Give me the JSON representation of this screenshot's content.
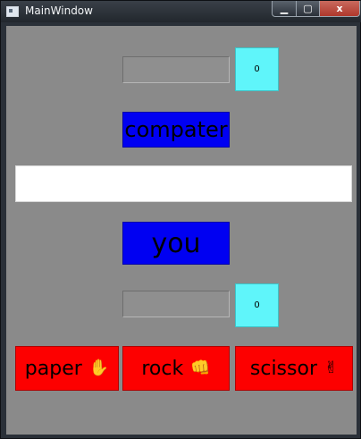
{
  "window": {
    "title": "MainWindow"
  },
  "controls": {
    "minimize": "▁",
    "maximize": "▢",
    "close": "x"
  },
  "computer": {
    "label": "compater",
    "score": "0"
  },
  "you": {
    "label": "you",
    "score": "0"
  },
  "buttons": {
    "paper": {
      "label": "paper",
      "icon": "✋"
    },
    "rock": {
      "label": "rock",
      "icon": "👊"
    },
    "scissor": {
      "label": "scissor",
      "icon": "✌"
    }
  },
  "colors": {
    "accent_blue": "#0000f2",
    "cyan": "#5ff5fa",
    "red": "#fd0000"
  }
}
